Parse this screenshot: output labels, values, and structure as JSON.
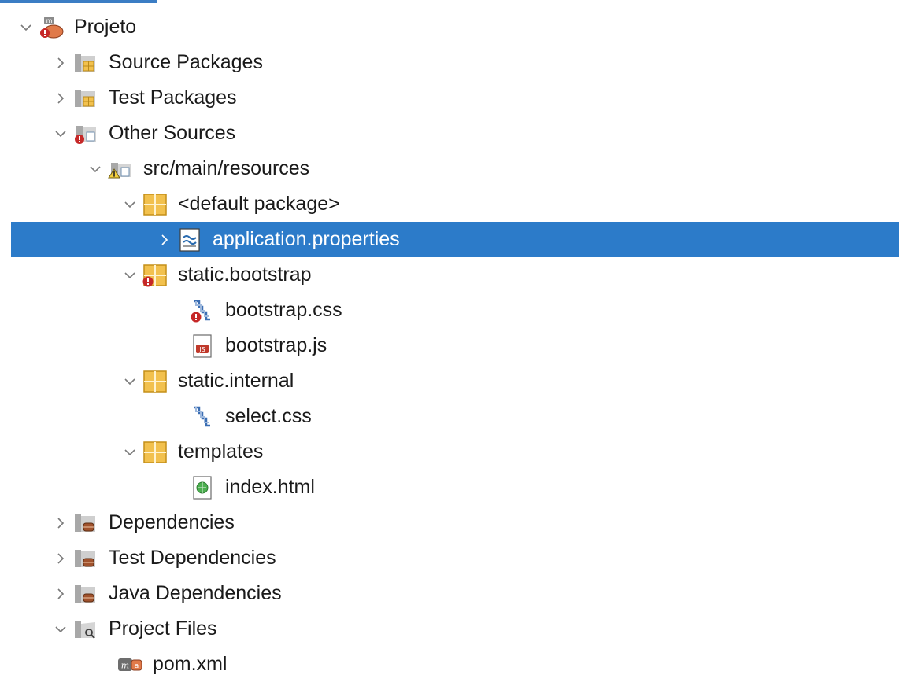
{
  "tree": {
    "root": {
      "label": "Projeto",
      "icon": "maven-project-icon",
      "expanded": true
    },
    "source_packages": {
      "label": "Source Packages",
      "icon": "source-packages-icon",
      "expanded": false
    },
    "test_packages": {
      "label": "Test Packages",
      "icon": "test-packages-icon",
      "expanded": false
    },
    "other_sources": {
      "label": "Other Sources",
      "icon": "other-sources-error-icon",
      "expanded": true
    },
    "src_main_resources": {
      "label": "src/main/resources",
      "icon": "resources-warning-icon",
      "expanded": true
    },
    "default_package": {
      "label": "<default package>",
      "icon": "package-icon",
      "expanded": true
    },
    "application_properties": {
      "label": "application.properties",
      "icon": "properties-file-icon",
      "expanded": false,
      "selected": true
    },
    "static_bootstrap": {
      "label": "static.bootstrap",
      "icon": "package-error-icon",
      "expanded": true
    },
    "bootstrap_css": {
      "label": "bootstrap.css",
      "icon": "css-file-error-icon"
    },
    "bootstrap_js": {
      "label": "bootstrap.js",
      "icon": "js-file-icon"
    },
    "static_internal": {
      "label": "static.internal",
      "icon": "package-icon",
      "expanded": true
    },
    "select_css": {
      "label": "select.css",
      "icon": "css-file-icon"
    },
    "templates": {
      "label": "templates",
      "icon": "package-icon",
      "expanded": true
    },
    "index_html": {
      "label": "index.html",
      "icon": "html-file-icon"
    },
    "dependencies": {
      "label": "Dependencies",
      "icon": "dependencies-icon",
      "expanded": false
    },
    "test_dependencies": {
      "label": "Test Dependencies",
      "icon": "dependencies-icon",
      "expanded": false
    },
    "java_dependencies": {
      "label": "Java Dependencies",
      "icon": "dependencies-icon",
      "expanded": false
    },
    "project_files": {
      "label": "Project Files",
      "icon": "project-files-icon",
      "expanded": true
    },
    "pom_xml": {
      "label": "pom.xml",
      "icon": "maven-pom-icon"
    }
  },
  "colors": {
    "selection": "#2c7bc9",
    "package_yellow": "#f2c14e",
    "error_red": "#c62828",
    "folder_gray": "#b0b0b0"
  }
}
